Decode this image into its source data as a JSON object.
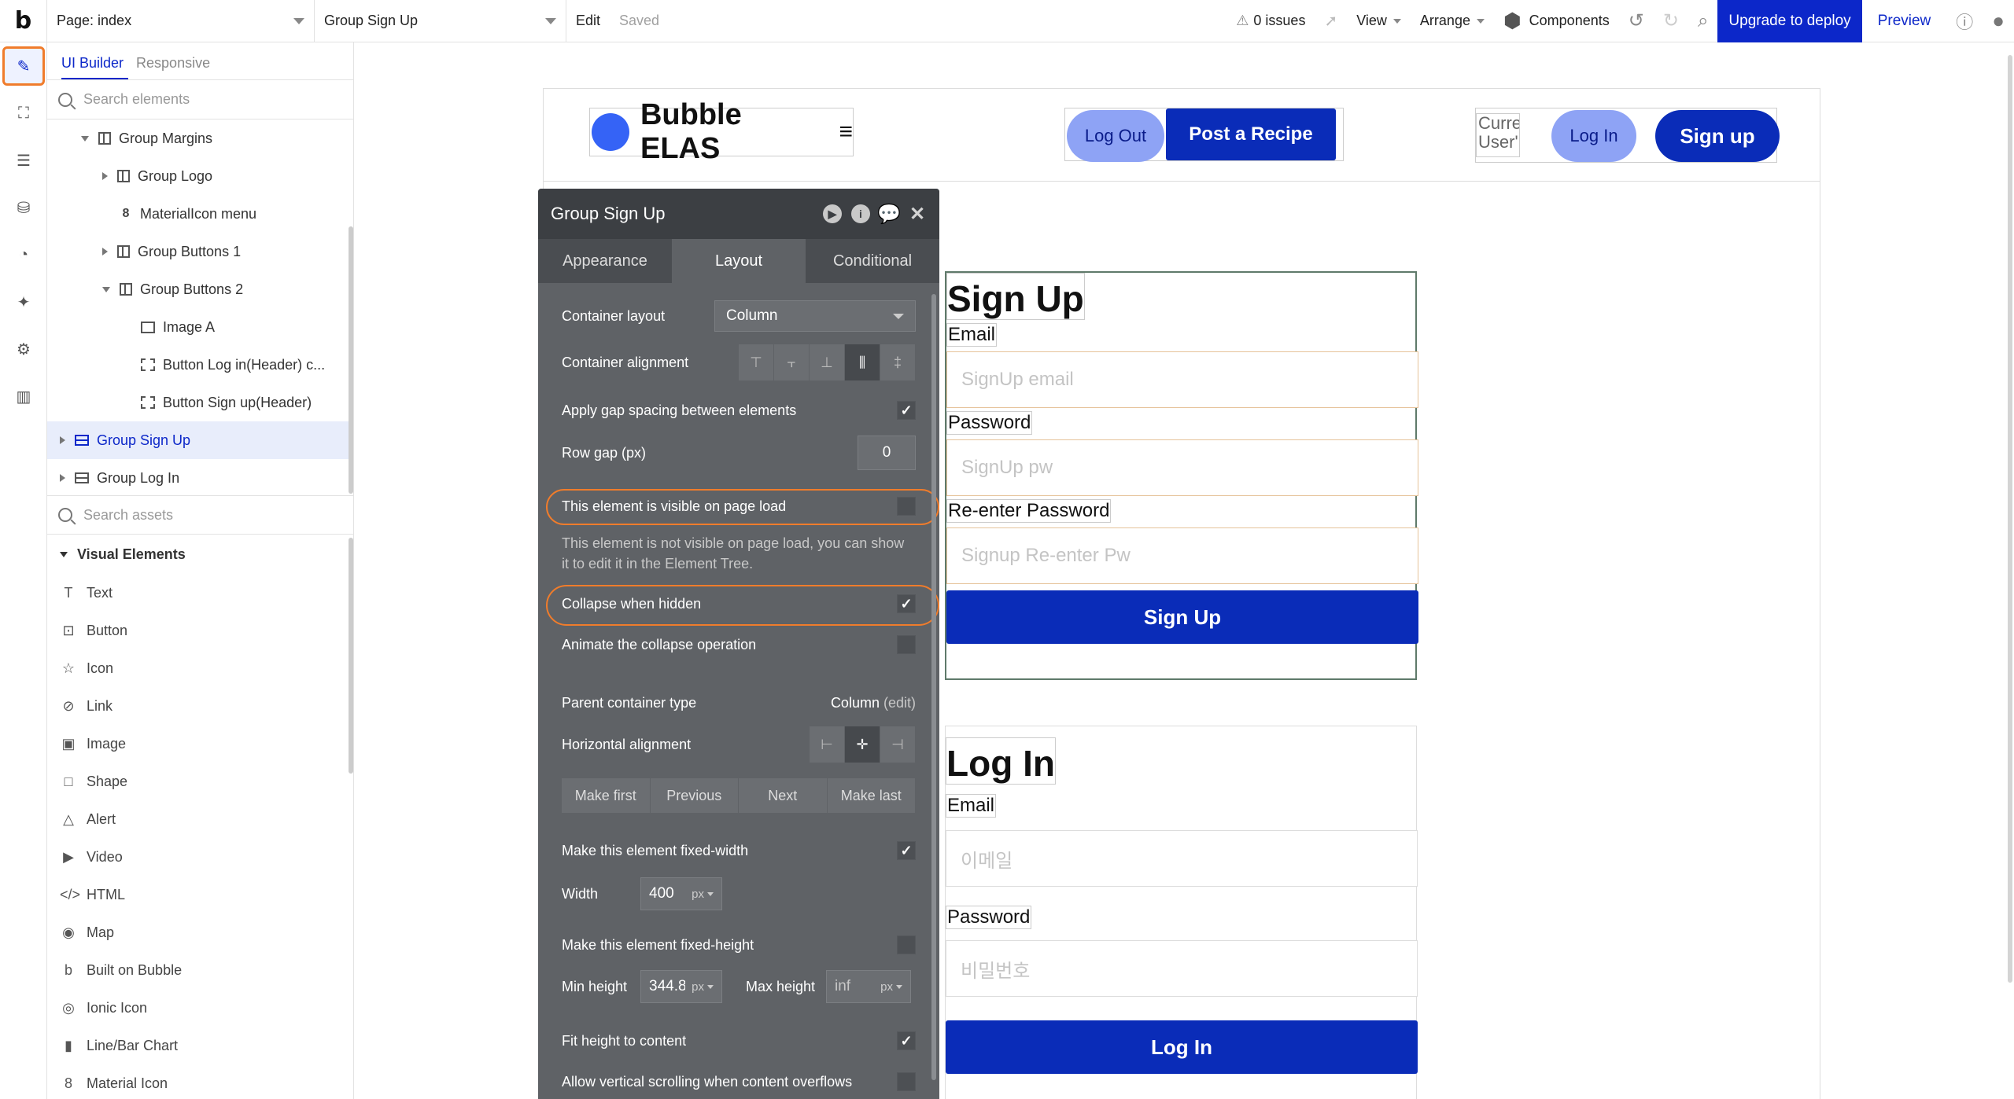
{
  "topbar": {
    "logo": "b",
    "page_select": "Page: index",
    "element_select": "Group Sign Up",
    "edit_label": "Edit",
    "saved_label": "Saved",
    "issues_label": "0 issues",
    "view_label": "View",
    "arrange_label": "Arrange",
    "components_label": "Components",
    "upgrade_label": "Upgrade to deploy",
    "preview_label": "Preview"
  },
  "left_panel": {
    "tabs": [
      "UI Builder",
      "Responsive"
    ],
    "search_elements_placeholder": "Search elements",
    "tree": [
      {
        "label": "Group Margins",
        "indent": 1,
        "toggle": "down",
        "icon": "col"
      },
      {
        "label": "Group Logo",
        "indent": 2,
        "toggle": "right",
        "icon": "col"
      },
      {
        "label": "MaterialIcon menu",
        "indent": 2,
        "toggle": "none",
        "icon": "mat"
      },
      {
        "label": "Group Buttons 1",
        "indent": 2,
        "toggle": "right",
        "icon": "col"
      },
      {
        "label": "Group Buttons 2",
        "indent": 2,
        "toggle": "down",
        "icon": "col"
      },
      {
        "label": "Image A",
        "indent": 3,
        "toggle": "none",
        "icon": "img"
      },
      {
        "label": "Button Log in(Header) c...",
        "indent": 3,
        "toggle": "none",
        "icon": "btn"
      },
      {
        "label": "Button Sign up(Header)",
        "indent": 3,
        "toggle": "none",
        "icon": "btn"
      },
      {
        "label": "Group Sign Up",
        "indent": 0,
        "toggle": "right",
        "icon": "row",
        "selected": true
      },
      {
        "label": "Group Log In",
        "indent": 0,
        "toggle": "right",
        "icon": "row"
      }
    ],
    "search_assets_placeholder": "Search assets",
    "visual_elements_header": "Visual Elements",
    "visual_elements": [
      {
        "label": "Text",
        "glyph": "T"
      },
      {
        "label": "Button",
        "glyph": "⊡"
      },
      {
        "label": "Icon",
        "glyph": "☆"
      },
      {
        "label": "Link",
        "glyph": "⊘"
      },
      {
        "label": "Image",
        "glyph": "▣"
      },
      {
        "label": "Shape",
        "glyph": "□"
      },
      {
        "label": "Alert",
        "glyph": "△"
      },
      {
        "label": "Video",
        "glyph": "▶"
      },
      {
        "label": "HTML",
        "glyph": "</>"
      },
      {
        "label": "Map",
        "glyph": "◉"
      },
      {
        "label": "Built on Bubble",
        "glyph": "b"
      },
      {
        "label": "Ionic Icon",
        "glyph": "◎"
      },
      {
        "label": "Line/Bar Chart",
        "glyph": "▮"
      },
      {
        "label": "Material Icon",
        "glyph": "8"
      }
    ]
  },
  "header": {
    "title": "Bubble ELAS",
    "logout_label": "Log Out",
    "post_label": "Post a Recipe",
    "user_text": "Curre User'",
    "login_label": "Log In",
    "signup_label": "Sign up"
  },
  "signup_form": {
    "title": "Sign Up",
    "email_label": "Email",
    "email_placeholder": "SignUp email",
    "password_label": "Password",
    "password_placeholder": "SignUp pw",
    "reenter_label": "Re-enter Password",
    "reenter_placeholder": "Signup Re-enter Pw",
    "submit_label": "Sign Up"
  },
  "login_form": {
    "title": "Log In",
    "email_label": "Email",
    "email_placeholder": "이메일",
    "password_label": "Password",
    "password_placeholder": "비밀번호",
    "submit_label": "Log In"
  },
  "editor": {
    "title": "Group Sign Up",
    "tabs": [
      "Appearance",
      "Layout",
      "Conditional"
    ],
    "container_layout_label": "Container layout",
    "container_layout_value": "Column",
    "container_alignment_label": "Container alignment",
    "gap_label": "Apply gap spacing between elements",
    "row_gap_label": "Row gap (px)",
    "row_gap_value": "0",
    "visible_label": "This element is visible on page load",
    "visible_help": "This element is not visible on page load, you can show it to edit it in the Element Tree.",
    "collapse_label": "Collapse when hidden",
    "animate_label": "Animate the collapse operation",
    "parent_type_label": "Parent container type",
    "parent_type_value": "Column",
    "parent_type_edit": "(edit)",
    "h_align_label": "Horizontal alignment",
    "order_buttons": [
      "Make first",
      "Previous",
      "Next",
      "Make last"
    ],
    "fixed_width_label": "Make this element fixed-width",
    "width_label": "Width",
    "width_value": "400",
    "width_unit": "px",
    "fixed_height_label": "Make this element fixed-height",
    "min_height_label": "Min height",
    "min_height_value": "344.8",
    "min_height_unit": "px",
    "max_height_label": "Max height",
    "max_height_value": "inf",
    "max_height_unit": "px",
    "fit_height_label": "Fit height to content",
    "scroll_label": "Allow vertical scrolling when content overflows"
  },
  "colors": {
    "accent": "#0c27c9",
    "highlight": "#f07c2b",
    "editor_bg": "#5f6266"
  }
}
